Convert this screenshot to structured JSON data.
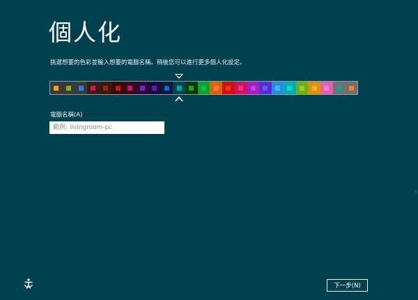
{
  "header": {
    "title": "個人化"
  },
  "instructions": "挑選想要的色彩並輸入想要的電腦名稱。稍後您可以進行更多個人化設定。",
  "color_picker": {
    "selected_index": 7,
    "swatches": [
      {
        "bg": "#3a3a3a",
        "chip": "#e8a800"
      },
      {
        "bg": "#3a3a3a",
        "chip": "#7fb800"
      },
      {
        "bg": "#3a3a3a",
        "chip": "#2f7fe0"
      },
      {
        "bg": "#3a1a1a",
        "chip": "#c02050"
      },
      {
        "bg": "#3a1a0a",
        "chip": "#8a2a10"
      },
      {
        "bg": "#3a0a0a",
        "chip": "#c01a1a"
      },
      {
        "bg": "#3a0a1a",
        "chip": "#c01a6a"
      },
      {
        "bg": "#2a0a3a",
        "chip": "#8020c0"
      },
      {
        "bg": "#1a0a3a",
        "chip": "#5a20c0"
      },
      {
        "bg": "#0a1a3a",
        "chip": "#2060d0"
      },
      {
        "bg": "#004850",
        "chip": "#0aa0b0"
      },
      {
        "bg": "#0a3a0a",
        "chip": "#20a020"
      },
      {
        "bg": "#10a030",
        "chip": "#10c040"
      },
      {
        "bg": "#e06010",
        "chip": "#f08030"
      },
      {
        "bg": "#d01010",
        "chip": "#f03030"
      },
      {
        "bg": "#d01060",
        "chip": "#f03080"
      },
      {
        "bg": "#a020c0",
        "chip": "#c040e0"
      },
      {
        "bg": "#5030d0",
        "chip": "#7050f0"
      },
      {
        "bg": "#2090e0",
        "chip": "#50b0f0"
      },
      {
        "bg": "#00b0b0",
        "chip": "#20d0d0"
      },
      {
        "bg": "#70b010",
        "chip": "#90d030"
      },
      {
        "bg": "#e09010",
        "chip": "#f0b030"
      },
      {
        "bg": "#e060b0",
        "chip": "#f080d0"
      },
      {
        "bg": "#707070",
        "chip": "#10a0a0"
      },
      {
        "bg": "#707070",
        "chip": "#f08030"
      }
    ]
  },
  "computer_name": {
    "label": "電腦名稱(A)",
    "placeholder": "範例: livingroom-pc",
    "value": ""
  },
  "footer": {
    "next_label": "下一步(N)",
    "ease_of_access_icon": "ease-of-access-icon"
  }
}
